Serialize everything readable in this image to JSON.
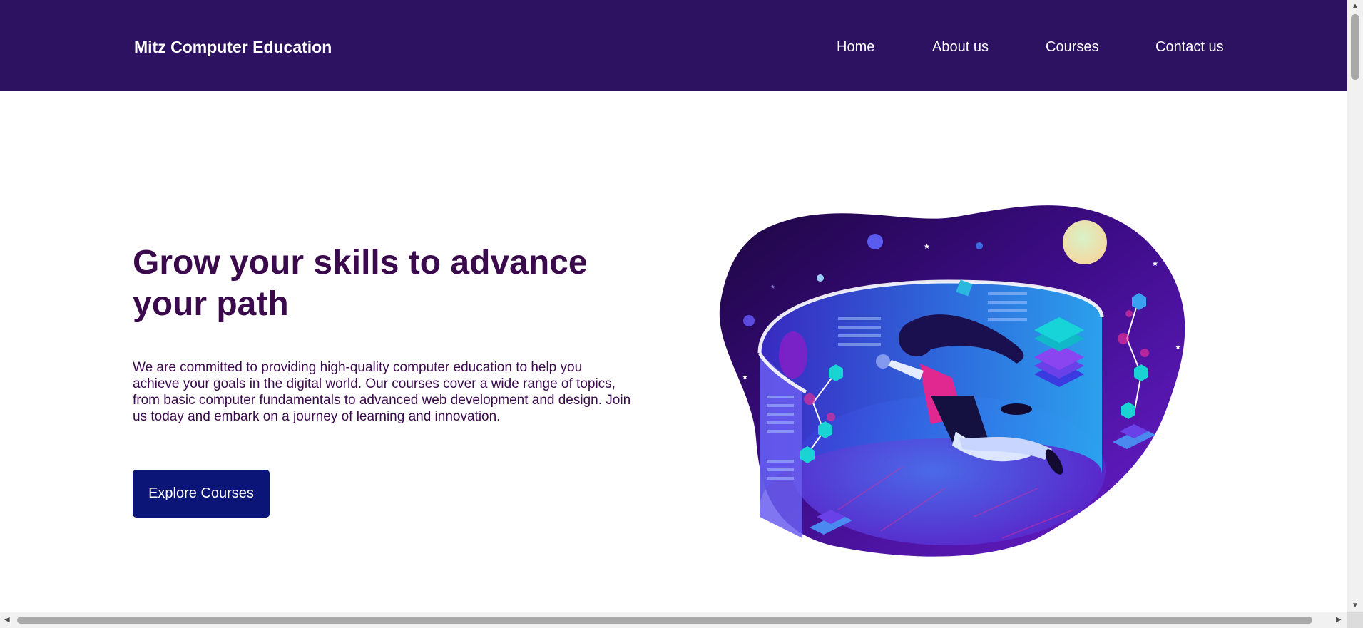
{
  "header": {
    "brand": "Mitz Computer Education",
    "nav": [
      {
        "label": "Home"
      },
      {
        "label": "About us"
      },
      {
        "label": "Courses"
      },
      {
        "label": "Contact us"
      }
    ]
  },
  "hero": {
    "title": "Grow your skills to advance your path",
    "description": "We are committed to providing high-quality computer education to help you achieve your goals in the digital world. Our courses cover a wide range of topics, from basic computer fundamentals to advanced web development and design. Join us today and embark on a journey of learning and innovation.",
    "cta_label": "Explore Courses",
    "illustration_icon": "virtual-reality-girl-illustration"
  },
  "colors": {
    "nav_bg": "#2c1260",
    "heading": "#3a0a4c",
    "button_bg": "#0b1577"
  }
}
